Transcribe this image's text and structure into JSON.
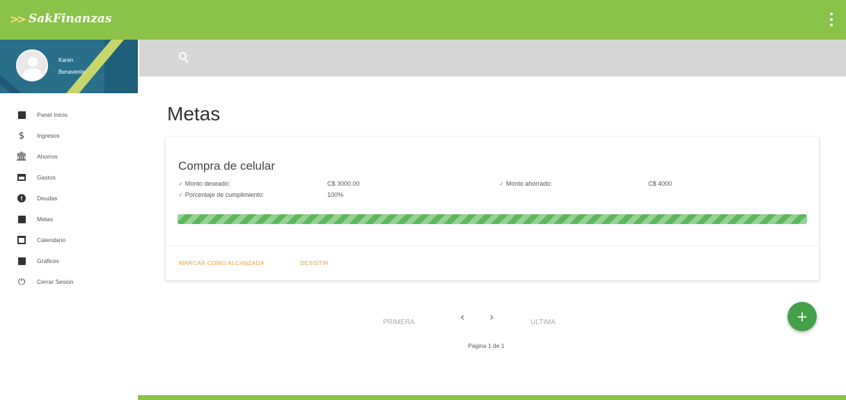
{
  "app": {
    "name": "SakFinanzas",
    "logo_mark": ">>"
  },
  "user": {
    "first_name": "Karen",
    "last_name": "Benavente"
  },
  "sidebar": {
    "items": [
      {
        "label": "Panel Inicio",
        "icon": "dashboard-icon"
      },
      {
        "label": "Ingresos",
        "icon": "dollar-icon"
      },
      {
        "label": "Ahorros",
        "icon": "bank-icon"
      },
      {
        "label": "Gastos",
        "icon": "credit-card-icon"
      },
      {
        "label": "Deudas",
        "icon": "alert-circle-icon"
      },
      {
        "label": "Metas",
        "icon": "check-box-icon"
      },
      {
        "label": "Calendario",
        "icon": "calendar-icon"
      },
      {
        "label": "Graficos",
        "icon": "chart-icon"
      },
      {
        "label": "Cerrar Sesion",
        "icon": "power-icon"
      }
    ]
  },
  "page": {
    "title": "Metas"
  },
  "goal": {
    "title": "Compra de celular",
    "desired_label": "Monto deseado:",
    "desired_value": "C$ 3000.00",
    "saved_label": "Monto ahorrado:",
    "saved_value": "C$ 4000",
    "percent_label": "Porcentaje de cumplimiento:",
    "percent_value": "100%",
    "progress": 1.0,
    "progress_color": "#5cb85c",
    "action_complete": "MARCAR COMO ALCANZADA",
    "action_abandon": "DESISTIR"
  },
  "pagination": {
    "first": "PRIMERA",
    "prev": "‹",
    "next": "›",
    "last": "ULTIMA",
    "info": "Página 1 de 1"
  },
  "fab": {
    "label": "+"
  },
  "colors": {
    "primary": "#8bc34a",
    "accent": "#f0a030",
    "fab": "#43a047"
  }
}
